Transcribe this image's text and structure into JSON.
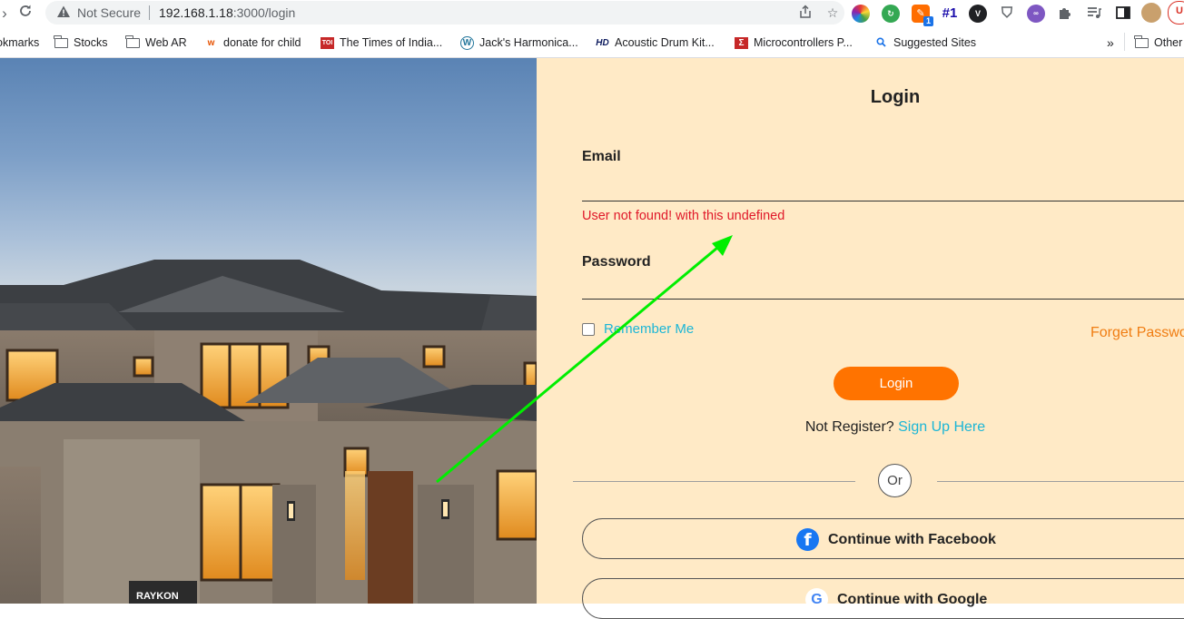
{
  "browser": {
    "security_label": "Not Secure",
    "url_host": "192.168.1.18",
    "url_path": ":3000/login",
    "bookmarks": [
      {
        "label": "okmarks",
        "icon": "none"
      },
      {
        "label": "Stocks",
        "icon": "folder-icon"
      },
      {
        "label": "Web AR",
        "icon": "folder-icon"
      },
      {
        "label": "donate for child",
        "icon": "site-icon"
      },
      {
        "label": "The Times of India...",
        "icon": "toi-icon"
      },
      {
        "label": "Jack's Harmonica...",
        "icon": "wordpress-icon"
      },
      {
        "label": "Acoustic Drum Kit...",
        "icon": "hd-icon"
      },
      {
        "label": "Microcontrollers P...",
        "icon": "sigma-icon"
      },
      {
        "label": "Suggested Sites",
        "icon": "search-icon"
      }
    ],
    "overflow_label": "»",
    "other_bookmarks": "Other",
    "badge_text": "1",
    "ext_hash_label": "#1"
  },
  "hero": {
    "sign_text": "RAYKON"
  },
  "login": {
    "title": "Login",
    "email_label": "Email",
    "email_value": "",
    "error_text": "User not found! with this undefined",
    "password_label": "Password",
    "password_value": "",
    "remember_label": "Remember Me",
    "forget_label": "Forget Password",
    "login_button": "Login",
    "register_prefix": "Not Register? ",
    "register_link": "Sign Up Here",
    "or_label": "Or",
    "facebook_button": "Continue with Facebook",
    "google_button": "Continue with Google"
  },
  "colors": {
    "panel_bg": "#ffeac6",
    "accent_orange": "#ff7300",
    "link_cyan": "#1cb6d6",
    "error_red": "#e0192a",
    "annotation_arrow": "#00ee00"
  }
}
